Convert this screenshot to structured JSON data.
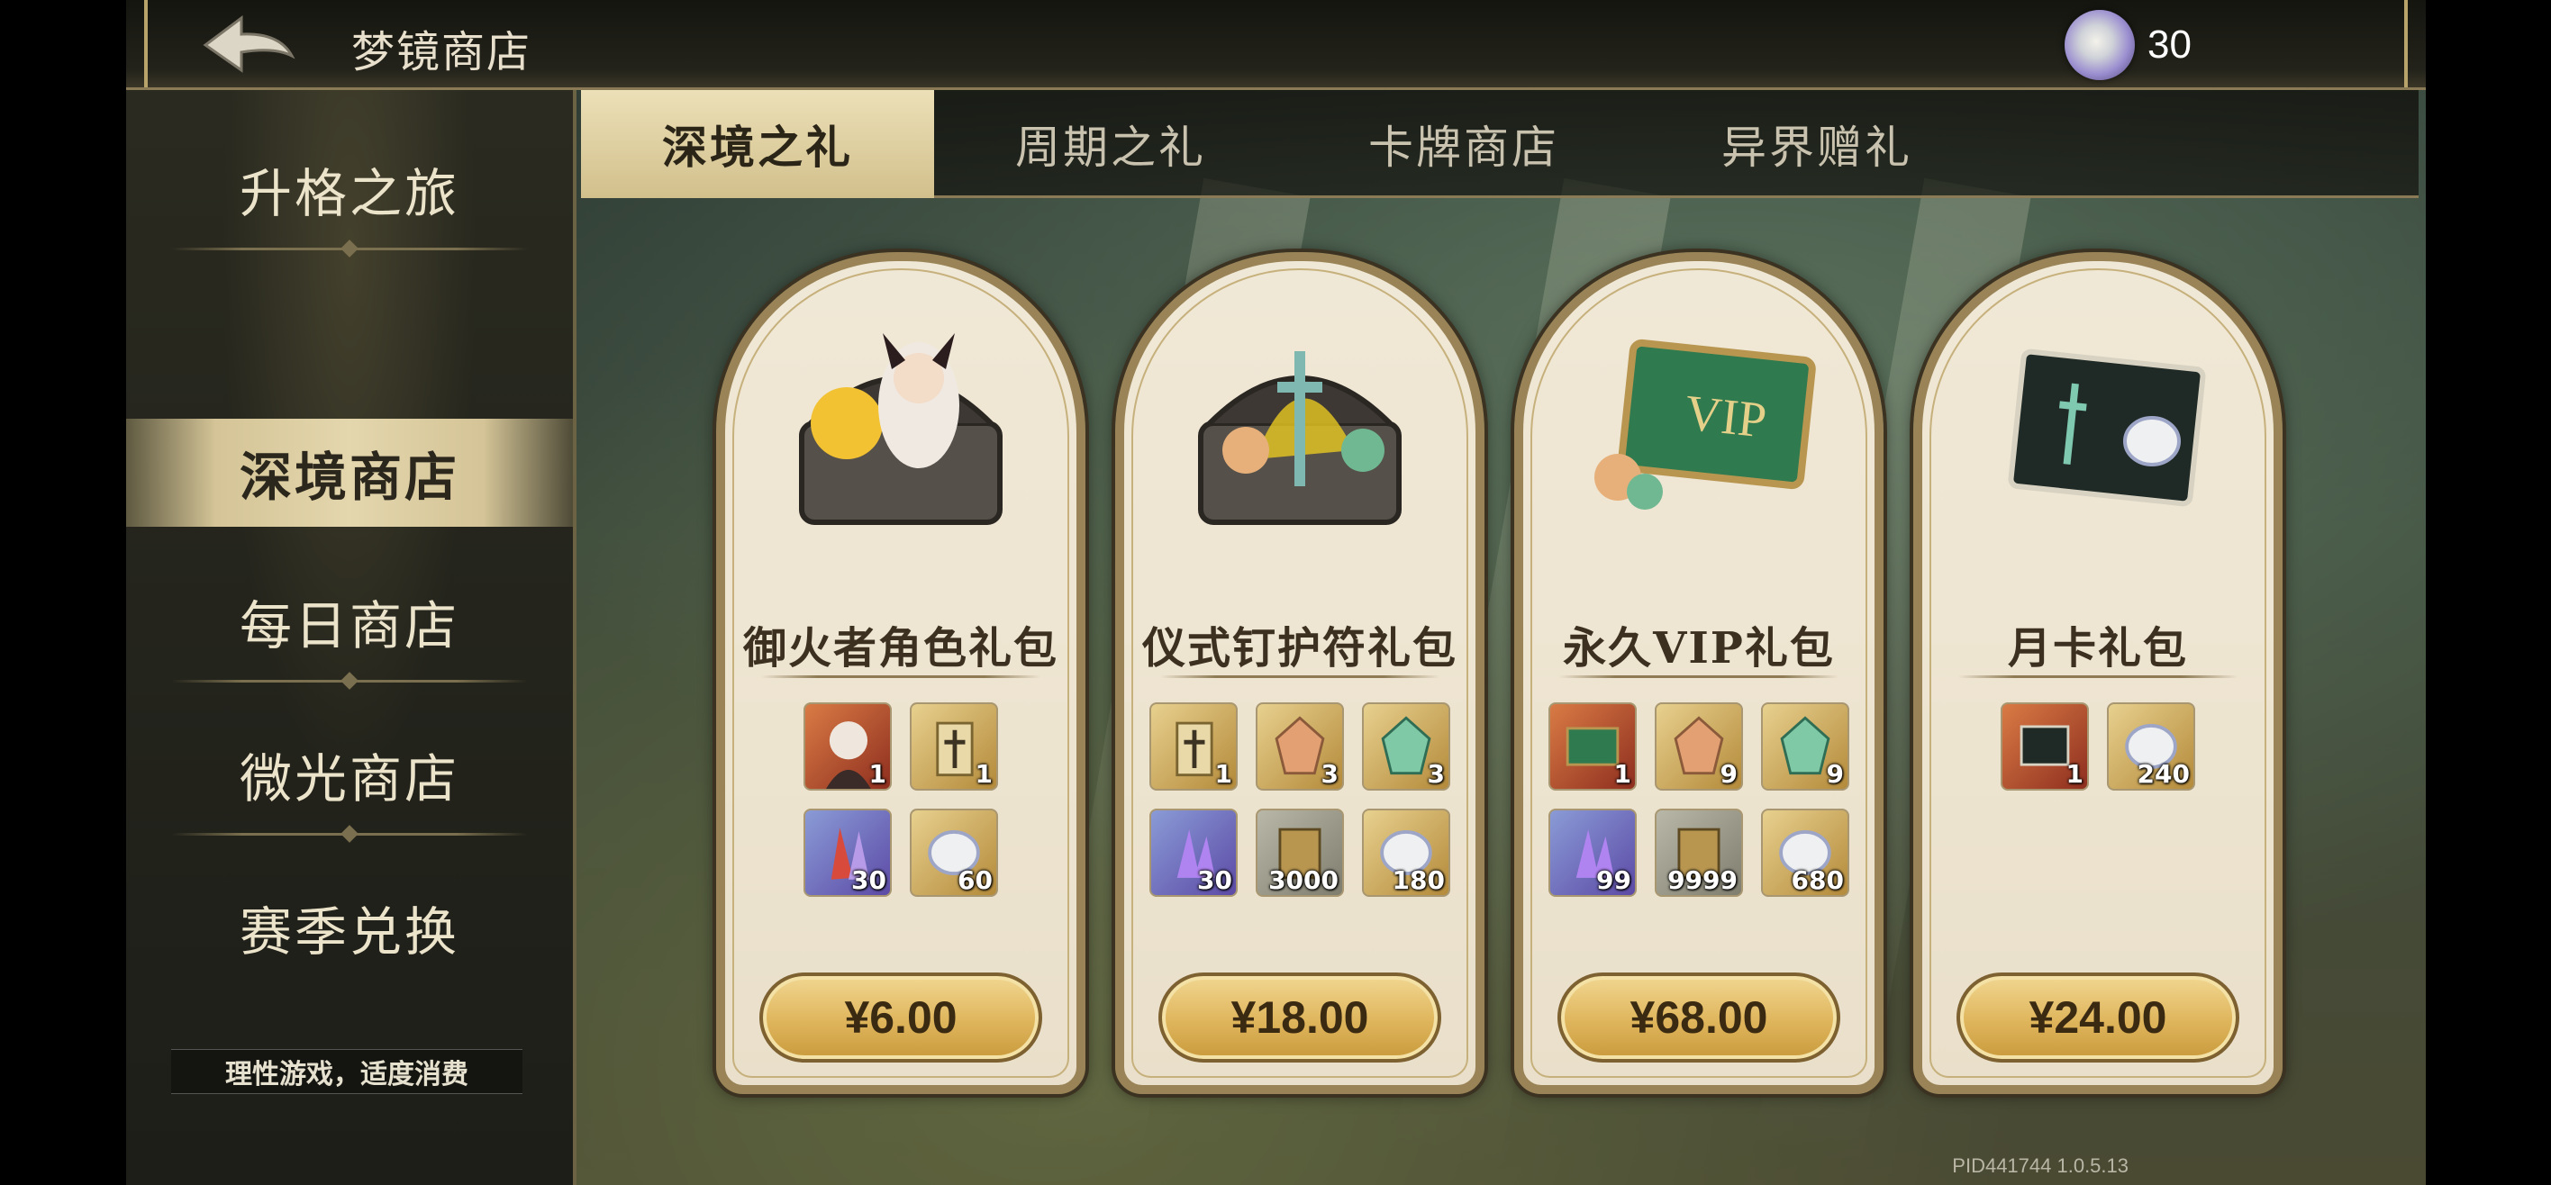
{
  "header": {
    "title": "梦镜商店",
    "currency_amount": "30",
    "currency_icon": "dream-crystal-icon"
  },
  "sidebar": {
    "items": [
      {
        "label": "升格之旅",
        "active": false
      },
      {
        "label": "深境商店",
        "active": true
      },
      {
        "label": "每日商店",
        "active": false
      },
      {
        "label": "微光商店",
        "active": false
      },
      {
        "label": "赛季兑换",
        "active": false
      }
    ],
    "notice": "理性游戏，适度消费"
  },
  "tabs": [
    {
      "label": "深境之礼",
      "active": true
    },
    {
      "label": "周期之礼",
      "active": false
    },
    {
      "label": "卡牌商店",
      "active": false
    },
    {
      "label": "异界赠礼",
      "active": false
    }
  ],
  "cards": [
    {
      "title": "御火者角色礼包",
      "price": "¥6.00",
      "art": "character-chest-icon",
      "items": [
        {
          "icon": "character-portrait-icon",
          "count": "1"
        },
        {
          "icon": "amulet-scroll-icon",
          "count": "1"
        },
        {
          "icon": "crystal-cluster-icon",
          "count": "30"
        },
        {
          "icon": "dream-crystal-icon",
          "count": "60"
        }
      ]
    },
    {
      "title": "仪式钉护符礼包",
      "price": "¥18.00",
      "art": "amulet-chest-icon",
      "items": [
        {
          "icon": "amulet-scroll-icon",
          "count": "1"
        },
        {
          "icon": "orange-shard-icon",
          "count": "3"
        },
        {
          "icon": "green-shard-icon",
          "count": "3"
        },
        {
          "icon": "purple-crystal-icon",
          "count": "30"
        },
        {
          "icon": "parchment-icon",
          "count": "3000"
        },
        {
          "icon": "dream-crystal-icon",
          "count": "180"
        }
      ]
    },
    {
      "title": "永久VIP礼包",
      "price": "¥68.00",
      "art": "vip-card-icon",
      "items": [
        {
          "icon": "vip-card-icon",
          "count": "1"
        },
        {
          "icon": "orange-shard-icon",
          "count": "9"
        },
        {
          "icon": "green-shard-icon",
          "count": "9"
        },
        {
          "icon": "purple-crystal-icon",
          "count": "99"
        },
        {
          "icon": "parchment-icon",
          "count": "9999"
        },
        {
          "icon": "dream-crystal-icon",
          "count": "680"
        }
      ]
    },
    {
      "title": "月卡礼包",
      "price": "¥24.00",
      "art": "monthly-card-icon",
      "items": [
        {
          "icon": "monthly-card-icon",
          "count": "1"
        },
        {
          "icon": "dream-crystal-icon",
          "count": "240"
        }
      ]
    }
  ],
  "footer": {
    "version": "PID441744  1.0.5.13"
  }
}
